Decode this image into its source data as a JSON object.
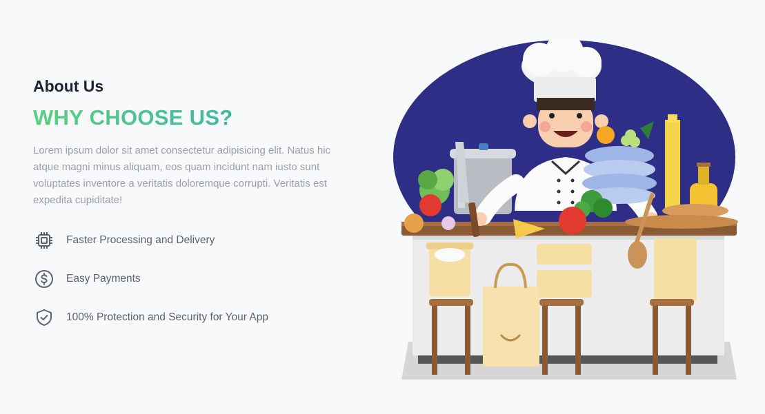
{
  "about": {
    "eyebrow": "About Us",
    "headline": "WHY CHOOSE US?",
    "lede": "Lorem ipsum dolor sit amet consectetur adipisicing elit. Natus hic atque magni minus aliquam, eos quam incidunt nam iusto sunt voluptates inventore a veritatis doloremque corrupti. Veritatis est expedita cupiditate!",
    "features": [
      {
        "icon": "cpu-chip-icon",
        "label": "Faster Processing and Delivery"
      },
      {
        "icon": "dollar-circle-icon",
        "label": "Easy Payments"
      },
      {
        "icon": "shield-check-icon",
        "label": "100% Protection and Security for Your App"
      }
    ]
  },
  "colors": {
    "heading": "#1c2333",
    "gradient_start": "#5ad07f",
    "gradient_end": "#2ea8b8",
    "body_text": "#9aa0ab",
    "feature_text": "#5b6270",
    "icon": "#5b6270",
    "illustration_backdrop": "#2e2e87"
  },
  "illustration": {
    "icon": "chef-kitchen-illustration"
  }
}
